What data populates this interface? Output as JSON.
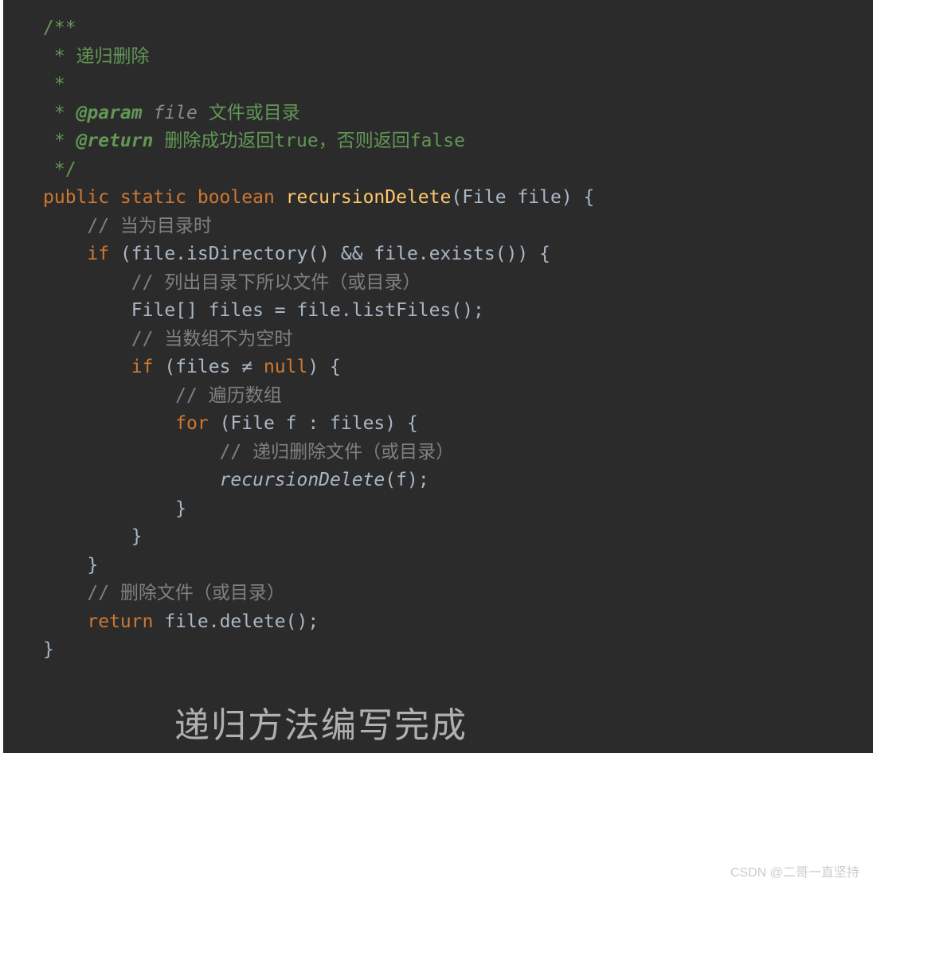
{
  "code": {
    "l1": "/**",
    "l2_pre": " * ",
    "l2_text": "递归删除",
    "l3": " *",
    "l4_pre": " * ",
    "l4_tag": "@param",
    "l4_param": " file",
    "l4_desc": " 文件或目录",
    "l5_pre": " * ",
    "l5_tag": "@return",
    "l5_desc": " 删除成功返回true，否则返回false",
    "l6": " */",
    "l7_kw1": "public static boolean ",
    "l7_method": "recursionDelete",
    "l7_sig": "(File file) {",
    "l8_indent": "    ",
    "l8_comment": "// 当为目录时",
    "l9_indent": "    ",
    "l9_kw": "if ",
    "l9_cond": "(file.isDirectory() && file.exists()) {",
    "l10_indent": "        ",
    "l10_comment": "// 列出目录下所以文件（或目录）",
    "l11_indent": "        ",
    "l11_code": "File[] files = file.listFiles();",
    "l12_indent": "        ",
    "l12_comment": "// 当数组不为空时",
    "l13_indent": "        ",
    "l13_kw": "if ",
    "l13_p1": "(files ≠ ",
    "l13_null": "null",
    "l13_p2": ") {",
    "l14_indent": "            ",
    "l14_comment": "// 遍历数组",
    "l15_indent": "            ",
    "l15_kw": "for ",
    "l15_loop": "(File f : files) {",
    "l16_indent": "                ",
    "l16_comment": "// 递归删除文件（或目录）",
    "l17_indent": "                ",
    "l17_call": "recursionDelete",
    "l17_arg": "(f);",
    "l18_indent": "            ",
    "l18_brace": "}",
    "l19_indent": "        ",
    "l19_brace": "}",
    "l20_indent": "    ",
    "l20_brace": "}",
    "l21_indent": "    ",
    "l21_comment": "// 删除文件（或目录）",
    "l22_indent": "    ",
    "l22_kw": "return ",
    "l22_code": "file.delete();",
    "l23": "}"
  },
  "caption": "递归方法编写完成",
  "watermark": "CSDN @二哥一直坚持"
}
